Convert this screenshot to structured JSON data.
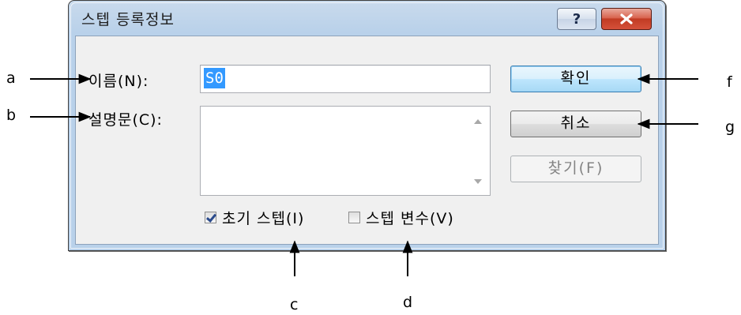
{
  "dialog": {
    "title": "스텝 등록정보",
    "help_label": "?",
    "name_label": "이름(N):",
    "name_value": "S0",
    "description_label": "설명문(C):",
    "description_value": "",
    "initial_step": {
      "label": "초기 스텝(I)",
      "checked": true
    },
    "step_variable": {
      "label": "스텝 변수(V)",
      "checked": false
    },
    "buttons": {
      "ok": "확인",
      "cancel": "취소",
      "find": "찾기(F)"
    }
  },
  "annotations": {
    "a": "a",
    "b": "b",
    "c": "c",
    "d": "d",
    "f": "f",
    "g": "g"
  },
  "colors": {
    "titlebar": "#b9d1ea",
    "client": "#f0f0f0",
    "selection": "#3399ff",
    "close_button": "#c13b23"
  }
}
